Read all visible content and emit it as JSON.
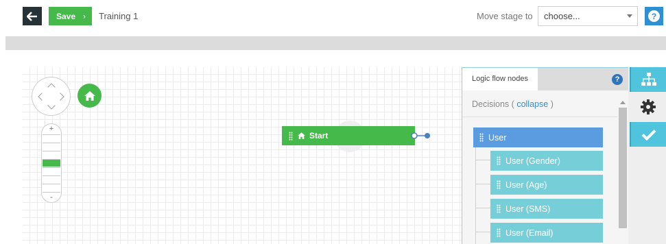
{
  "header": {
    "back_icon": "arrow-left-icon",
    "save_label": "Save",
    "save_chevron": "›",
    "title": "Training 1",
    "move_stage_label": "Move stage to",
    "stage_select": {
      "selected": "choose..."
    },
    "help_label": "?"
  },
  "canvas": {
    "navpad_icon": "pan-arrows-icon",
    "home_icon": "home-icon",
    "zoom": {
      "plus": "+",
      "minus": "-",
      "level_fraction": 0.5
    },
    "start_node": {
      "label": "Start",
      "color": "#45b94a"
    }
  },
  "panel": {
    "tab_label": "Logic flow nodes",
    "help_label": "?",
    "decisions_label": "Decisions",
    "collapse_label": "collapse",
    "paren_open": "(",
    "paren_close": ")",
    "root_node": {
      "label": "User",
      "color": "#5b9be0"
    },
    "child_nodes": [
      {
        "label": "User (Gender)"
      },
      {
        "label": "User (Age)"
      },
      {
        "label": "User (SMS)"
      },
      {
        "label": "User (Email)"
      }
    ],
    "child_color": "#76cfd8"
  },
  "side_toolbar": [
    {
      "icon": "flow-tree-icon",
      "active": true
    },
    {
      "icon": "gear-icon",
      "active": false
    },
    {
      "icon": "check-icon",
      "active": true
    }
  ],
  "colors": {
    "accent_green": "#45b94a",
    "accent_blue": "#2f8fd0",
    "accent_teal": "#4fc4dc"
  }
}
